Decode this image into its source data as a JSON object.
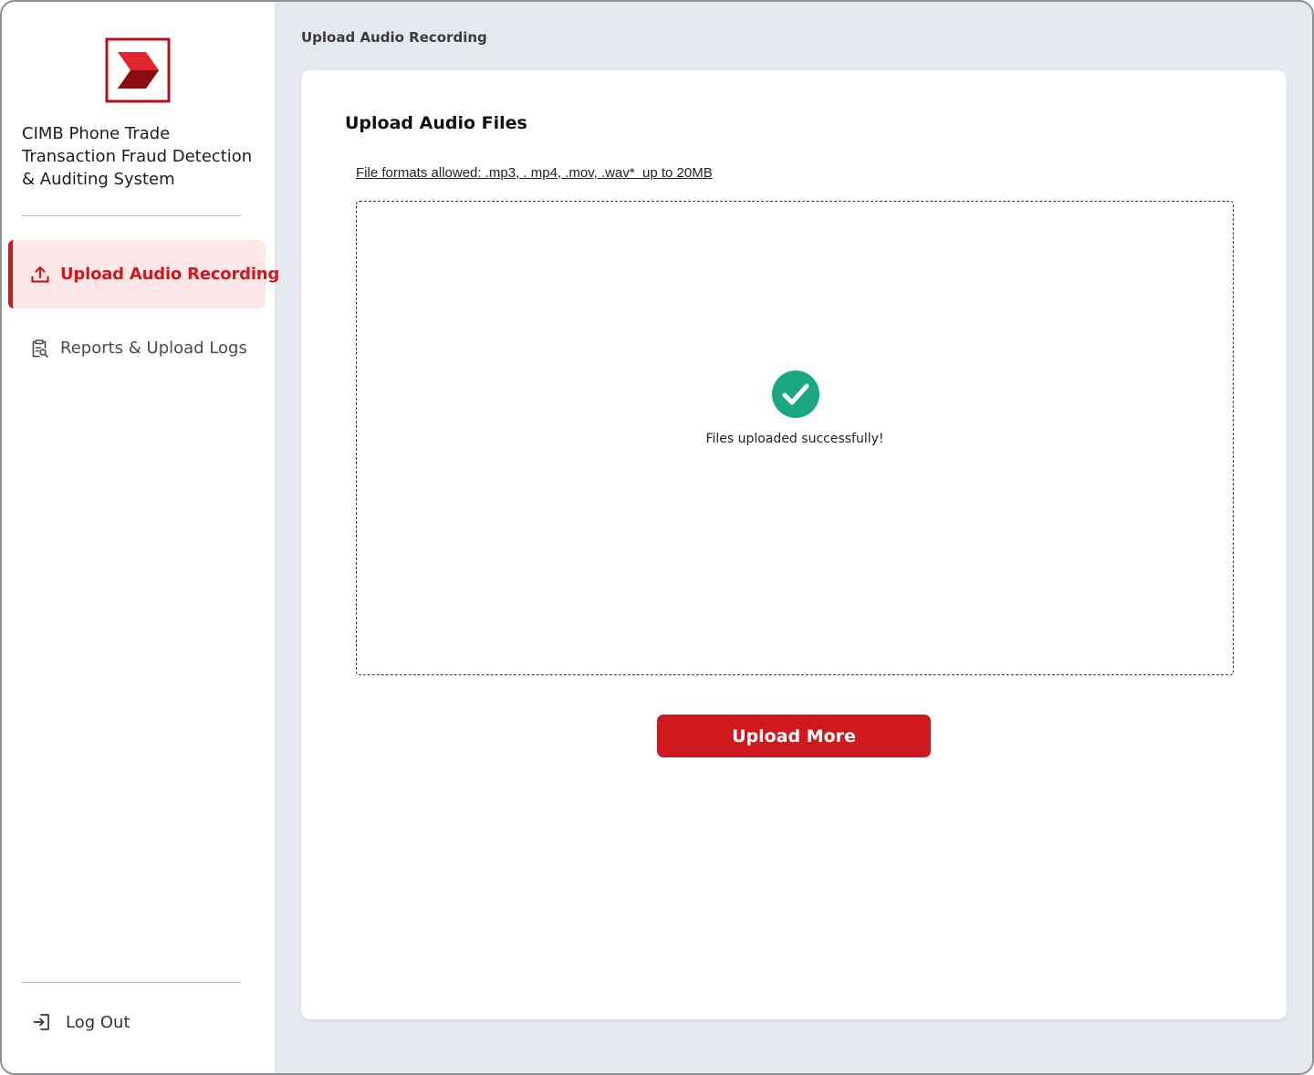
{
  "app": {
    "title": "CIMB Phone Trade Transaction Fraud Detection & Auditing System",
    "logo_icon": "cimb-logo-icon",
    "brand_color": "#d0191f"
  },
  "sidebar": {
    "items": [
      {
        "label": "Upload Audio Recording",
        "icon": "upload-icon",
        "active": true
      },
      {
        "label": "Reports & Upload Logs",
        "icon": "clipboard-search-icon",
        "active": false
      }
    ],
    "logout": {
      "label": "Log Out",
      "icon": "logout-icon"
    }
  },
  "header": {
    "title": "Upload Audio Recording"
  },
  "main": {
    "card_title": "Upload Audio Files",
    "formats_text": "File formats allowed: .mp3, . mp4, .mov, .wav*  up to 20MB",
    "success_message": "Files uploaded successfully!",
    "success_icon": "check-circle-icon",
    "success_color": "#1aa784",
    "upload_more_label": "Upload More"
  }
}
